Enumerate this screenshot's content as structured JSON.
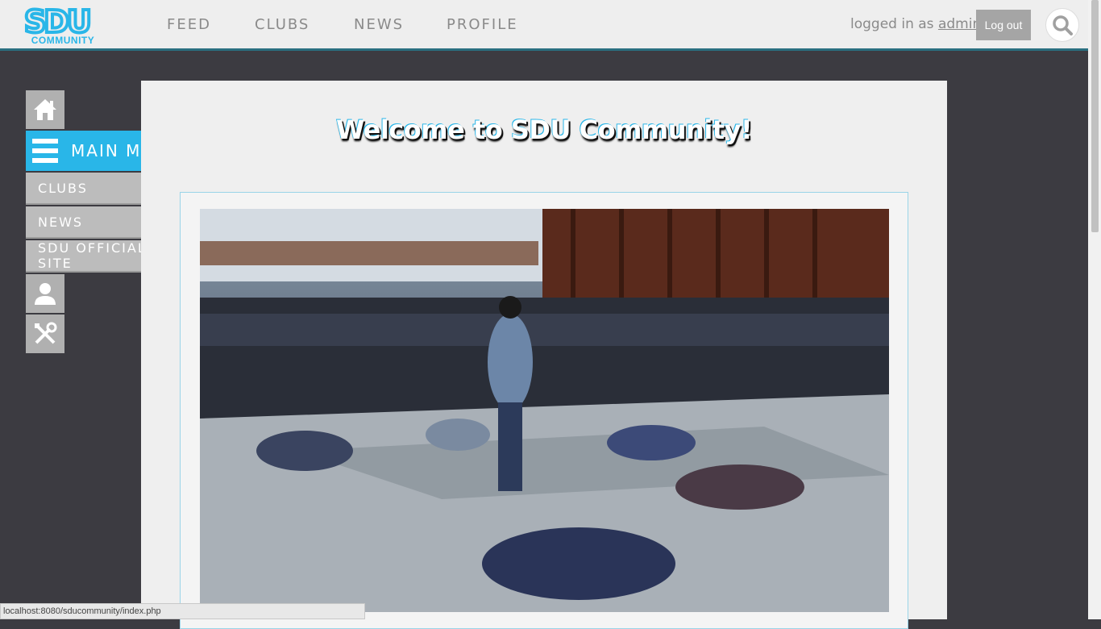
{
  "header": {
    "logo_text": "SDU",
    "logo_sub": "COMMUNITY",
    "nav": [
      "FEED",
      "CLUBS",
      "NEWS",
      "PROFILE"
    ],
    "logged_in_prefix": "logged in as",
    "username": "admin",
    "logout_label": "Log out"
  },
  "sidebar": {
    "main_menu_label": "MAIN MENU",
    "items": [
      "CLUBS",
      "NEWS",
      "SDU OFFICIAL SITE"
    ],
    "icons": [
      "home-icon",
      "hamburger-icon",
      "user-icon",
      "tools-icon"
    ]
  },
  "content": {
    "welcome": "Welcome to SDU Community!"
  },
  "status_bar": "localhost:8080/sducommunity/index.php",
  "colors": {
    "accent": "#29b6e8",
    "background": "#3c3b41",
    "panel": "#efefef",
    "menu_gray": "#bcbcbc"
  }
}
